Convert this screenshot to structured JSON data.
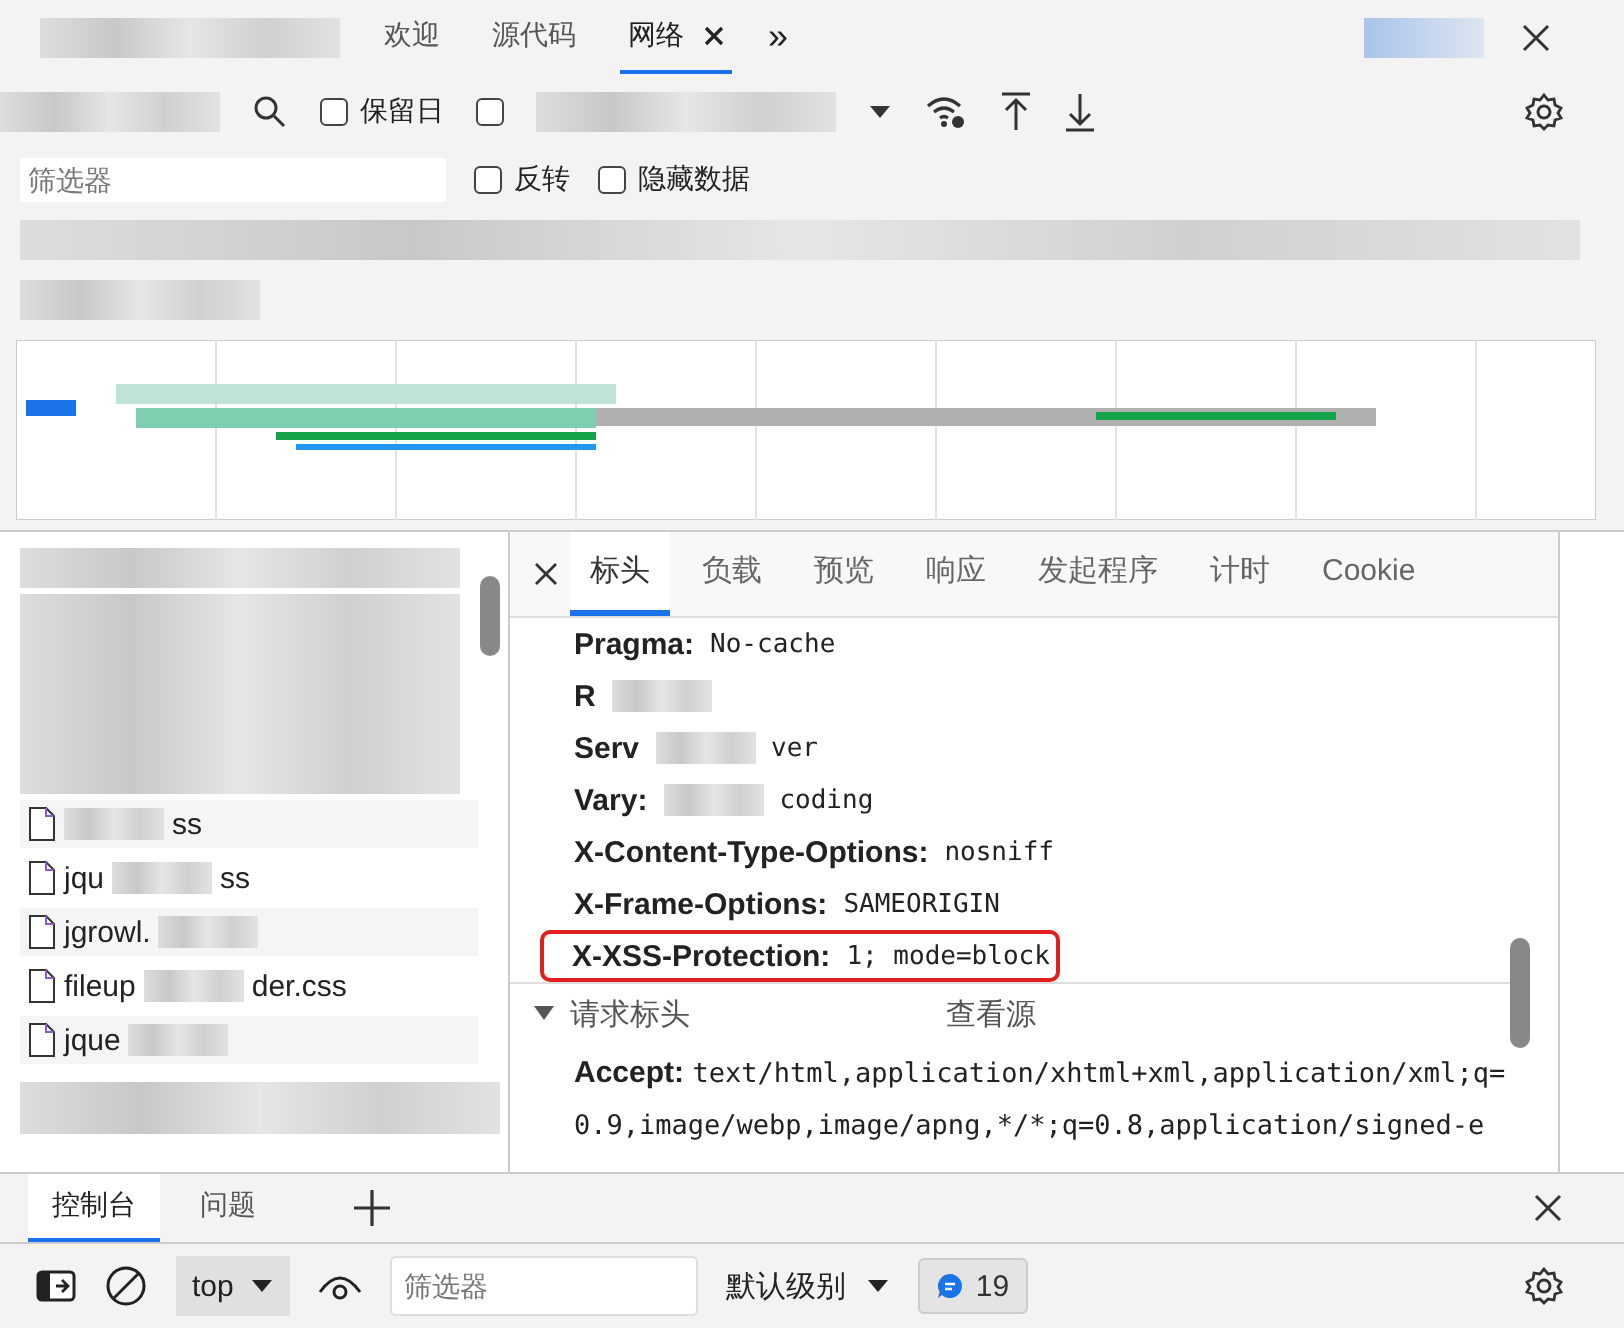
{
  "top_tabs": [
    {
      "label": "欢迎",
      "selected": false,
      "closable": false
    },
    {
      "label": "源代码",
      "selected": false,
      "closable": false
    },
    {
      "label": "网络",
      "selected": true,
      "closable": true
    }
  ],
  "more_tabs": "»",
  "toolbar": {
    "checkboxes": [
      {
        "label": "保留日",
        "checked": false
      },
      {
        "checked": false
      }
    ]
  },
  "filter_bar": {
    "placeholder": "筛选器",
    "checkboxes": [
      {
        "label": "反转",
        "checked": false
      },
      {
        "label": "隐藏数据",
        "checked": false
      }
    ]
  },
  "request_list": {
    "rows": [
      {
        "end": "ss"
      },
      {
        "start": "jqu",
        "end": "ss"
      },
      {
        "start": "jgrowl."
      },
      {
        "start": "fileup",
        "end": "der.css"
      },
      {
        "start": "jque"
      }
    ]
  },
  "details": {
    "tabs": [
      {
        "label": "标头",
        "selected": true
      },
      {
        "label": "负载",
        "selected": false
      },
      {
        "label": "预览",
        "selected": false
      },
      {
        "label": "响应",
        "selected": false
      },
      {
        "label": "发起程序",
        "selected": false
      },
      {
        "label": "计时",
        "selected": false
      },
      {
        "label": "Cookie",
        "selected": false
      }
    ],
    "response_headers": [
      {
        "name": "Pragma:",
        "value": "No-cache",
        "highlighted": false
      },
      {
        "name": "R",
        "highlighted": false
      },
      {
        "name": "Serv",
        "value_end": "ver",
        "highlighted": false
      },
      {
        "name": "Vary:",
        "value_end": "coding",
        "highlighted": false
      },
      {
        "name": "X-Content-Type-Options:",
        "value": "nosniff",
        "highlighted": false
      },
      {
        "name": "X-Frame-Options:",
        "value": "SAMEORIGIN",
        "highlighted": false
      },
      {
        "name": "X-XSS-Protection:",
        "value": "1; mode=block",
        "highlighted": true
      }
    ],
    "request_section": {
      "title": "请求标头",
      "expanded": true,
      "link": "查看源"
    },
    "request_headers": [
      {
        "name": "Accept:",
        "value": "text/html,application/xhtml+xml,application/xml;q=0.9,image/webp,image/apng,*/*;q=0.8,application/signed-e"
      }
    ]
  },
  "drawer": {
    "tabs": [
      {
        "label": "控制台",
        "selected": true
      },
      {
        "label": "问题",
        "selected": false
      }
    ],
    "context": "top",
    "filter_placeholder": "筛选器",
    "level": "默认级别",
    "issues": "19"
  }
}
